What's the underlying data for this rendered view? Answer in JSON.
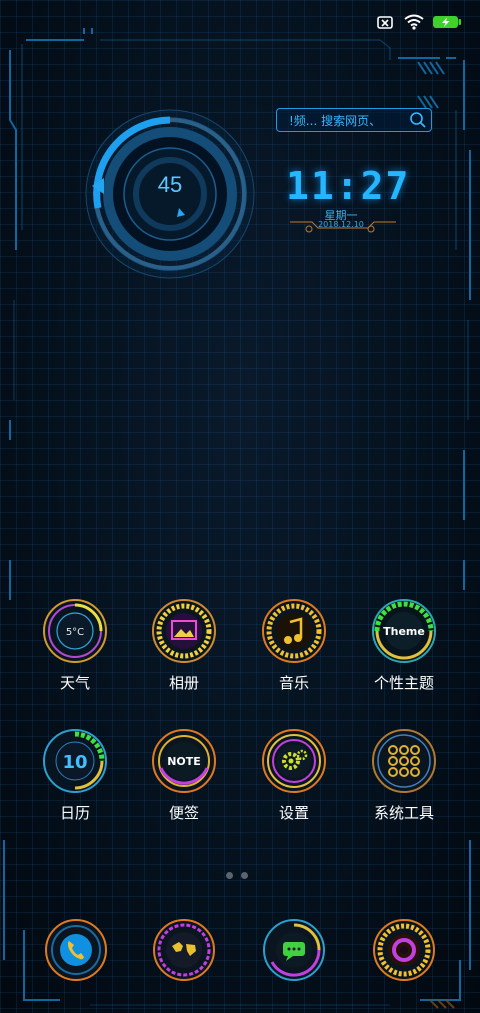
{
  "status_bar": {
    "icons": [
      "sim-error-icon",
      "wifi-icon",
      "battery-charging-icon"
    ],
    "battery_color": "#3ed12b"
  },
  "search": {
    "text": "!频...     搜索网页、"
  },
  "gauge": {
    "value": "45",
    "accent": "#1ea0f0"
  },
  "clock": {
    "time": "11:27",
    "weekday": "星期一",
    "date": "2018.12.10"
  },
  "apps": [
    {
      "label": "天气",
      "icon": "weather-icon",
      "badge": "5°C"
    },
    {
      "label": "相册",
      "icon": "gallery-icon"
    },
    {
      "label": "音乐",
      "icon": "music-icon"
    },
    {
      "label": "个性主题",
      "icon": "theme-icon",
      "badge": "Theme"
    },
    {
      "label": "日历",
      "icon": "calendar-icon",
      "badge": "10"
    },
    {
      "label": "便签",
      "icon": "notes-icon",
      "badge": "NOTE"
    },
    {
      "label": "设置",
      "icon": "settings-icon"
    },
    {
      "label": "系统工具",
      "icon": "tools-icon"
    }
  ],
  "pager": {
    "pages": 2,
    "current": 1
  },
  "dock": [
    {
      "icon": "phone-icon"
    },
    {
      "icon": "browser-icon"
    },
    {
      "icon": "messages-icon"
    },
    {
      "icon": "camera-icon"
    }
  ]
}
